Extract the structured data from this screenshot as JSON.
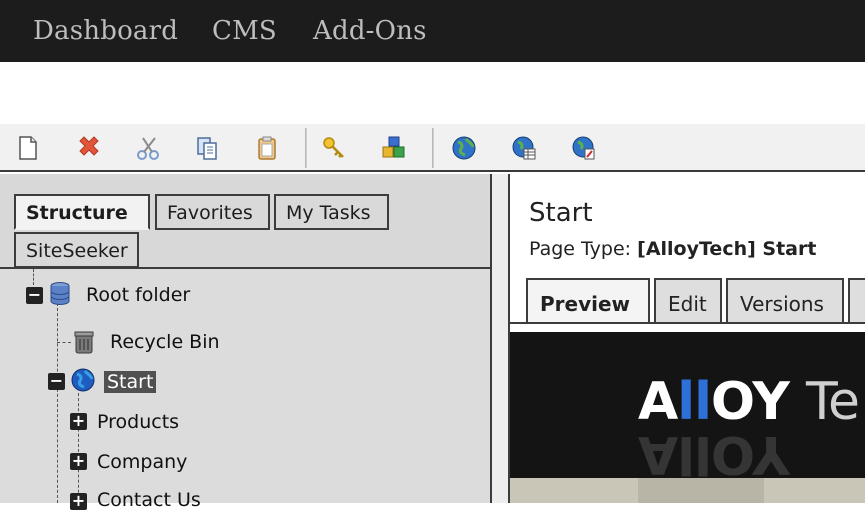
{
  "topnav": {
    "items": [
      "Dashboard",
      "CMS",
      "Add-Ons"
    ]
  },
  "toolbar": {
    "icons": [
      "new-page-icon",
      "delete-icon",
      "cut-icon",
      "copy-icon",
      "paste-icon",
      "key-icon",
      "blocks-icon",
      "globe-icon",
      "globe-table-icon",
      "globe-edit-icon"
    ]
  },
  "leftpanel": {
    "tabs": [
      "Structure",
      "Favorites",
      "My Tasks",
      "SiteSeeker"
    ],
    "active_tab": "Structure",
    "tree": {
      "root": "Root folder",
      "recycle": "Recycle Bin",
      "start": "Start",
      "products": "Products",
      "company": "Company",
      "contact": "Contact Us"
    }
  },
  "rightpanel": {
    "title": "Start",
    "pagetype_label": "Page Type:",
    "pagetype_value": "[AlloyTech] Start",
    "tabs": [
      "Preview",
      "Edit",
      "Versions"
    ],
    "active_tab": "Preview",
    "logo": {
      "part1": "A",
      "part2": "ll",
      "part3": "OY",
      "part4": "Te"
    }
  },
  "colors": {
    "topbar": "#1c1c1c",
    "selection": "#505050",
    "logo_blue": "#2e6fd8"
  }
}
